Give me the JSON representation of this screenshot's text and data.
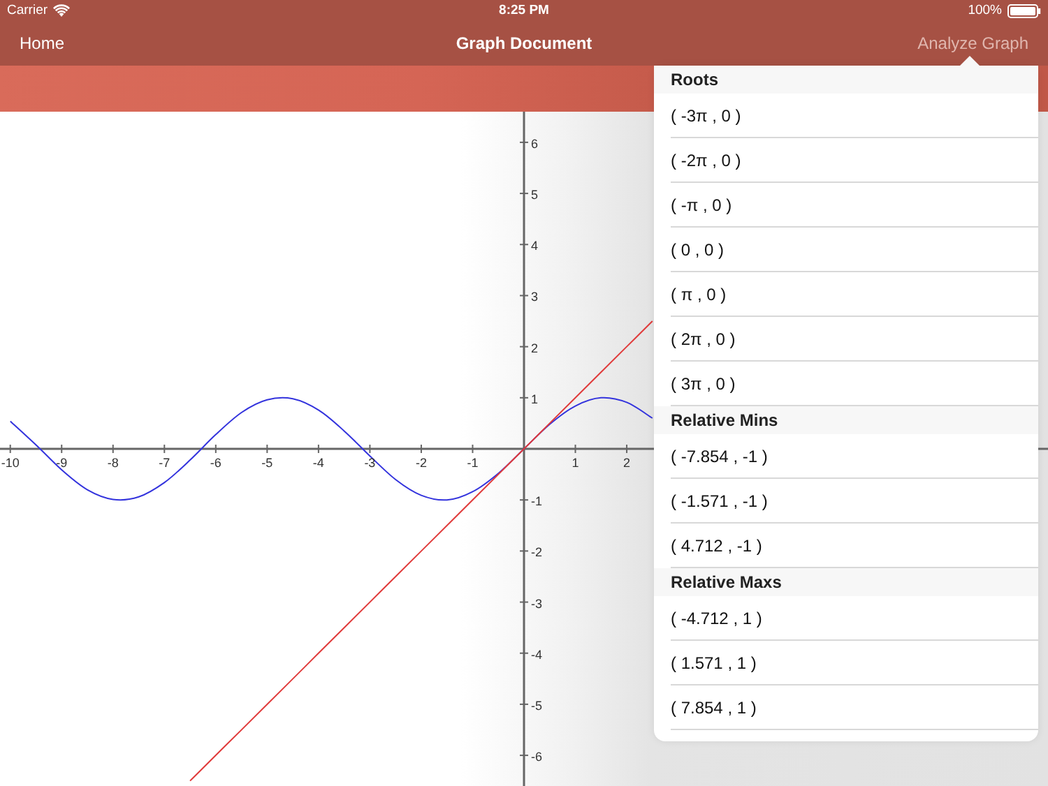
{
  "status_bar": {
    "carrier": "Carrier",
    "time": "8:25 PM",
    "battery": "100%"
  },
  "nav_bar": {
    "left_button": "Home",
    "title": "Graph Document",
    "right_button": "Analyze Graph"
  },
  "graph": {
    "chart_data": {
      "type": "line",
      "xlim": [
        -10.2,
        10.2
      ],
      "ylim": [
        -6.6,
        6.6
      ],
      "xticks": [
        -10,
        -9,
        -8,
        -7,
        -6,
        -5,
        -4,
        -3,
        -2,
        -1,
        1,
        2
      ],
      "yticks": [
        -6,
        -5,
        -4,
        -3,
        -2,
        -1,
        1,
        2,
        3,
        4,
        5,
        6
      ],
      "x": [
        -10,
        -9.5,
        -9,
        -8.5,
        -8,
        -7.5,
        -7,
        -6.5,
        -6,
        -5.5,
        -5,
        -4.5,
        -4,
        -3.5,
        -3,
        -2.5,
        -2,
        -1.5,
        -1,
        -0.5,
        0,
        0.5,
        1,
        1.5,
        2,
        2.5
      ],
      "series": [
        {
          "color": "#3333dd",
          "values": [
            0.54,
            0.08,
            -0.41,
            -0.8,
            -0.99,
            -0.94,
            -0.66,
            -0.22,
            0.28,
            0.71,
            0.96,
            0.98,
            0.76,
            0.35,
            -0.14,
            -0.6,
            -0.91,
            -1,
            -0.84,
            -0.48,
            0,
            0.48,
            0.84,
            1,
            0.91,
            0.6
          ]
        },
        {
          "color": "#e03a3a",
          "values": [
            null,
            null,
            null,
            null,
            null,
            null,
            null,
            -6.5,
            -6,
            -5.5,
            -5,
            -4.5,
            -4,
            -3.5,
            -3,
            -2.5,
            -2,
            -1.5,
            -1,
            -0.5,
            0,
            0.5,
            1,
            1.5,
            2,
            2.5
          ]
        }
      ]
    }
  },
  "popover": {
    "sections": [
      {
        "header": "Roots",
        "items": [
          "( -3π , 0 )",
          "( -2π , 0 )",
          "( -π , 0 )",
          "( 0 , 0 )",
          "( π , 0 )",
          "( 2π , 0 )",
          "( 3π , 0 )"
        ]
      },
      {
        "header": "Relative Mins",
        "items": [
          "( -7.854 , -1 )",
          "( -1.571 , -1 )",
          "( 4.712 , -1 )"
        ]
      },
      {
        "header": "Relative Maxs",
        "items": [
          "( -4.712 , 1 )",
          "( 1.571 , 1 )",
          "( 7.854 , 1 )"
        ]
      }
    ]
  }
}
